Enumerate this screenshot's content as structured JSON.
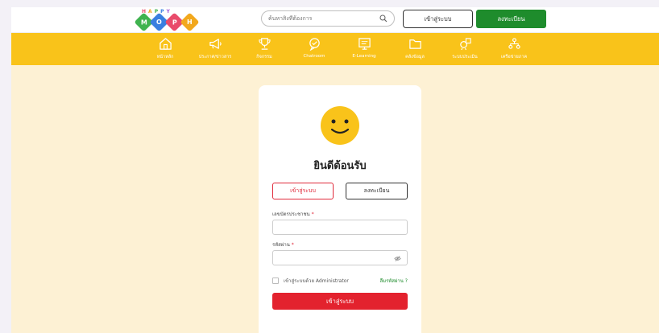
{
  "header": {
    "logo_word": "HAPPY",
    "logo_letters": [
      "M",
      "O",
      "P",
      "H"
    ],
    "logo_colors": [
      "#3fb34f",
      "#3a7fe0",
      "#e94b6b",
      "#f2a81d"
    ],
    "search_placeholder": "ค้นหาสิ่งที่ต้องการ",
    "login_label": "เข้าสู่ระบบ",
    "register_label": "ลงทะเบียน"
  },
  "nav": [
    {
      "label": "หน้าหลัก",
      "icon": "home-icon"
    },
    {
      "label": "ประกาศ/ข่าวสาร",
      "icon": "megaphone-icon"
    },
    {
      "label": "กิจกรรม",
      "icon": "trophy-icon"
    },
    {
      "label": "Chatroom",
      "icon": "chat-icon"
    },
    {
      "label": "E-Learning",
      "icon": "elearning-icon"
    },
    {
      "label": "คลังข้อมูล",
      "icon": "folder-icon"
    },
    {
      "label": "ระบบประเมิน",
      "icon": "assessment-icon"
    },
    {
      "label": "เครือข่ายภาค",
      "icon": "network-icon"
    }
  ],
  "login": {
    "welcome": "ยินดีต้อนรับ",
    "tab_login": "เข้าสู่ระบบ",
    "tab_register": "ลงทะเบียน",
    "id_label": "เลขบัตรประชาชน",
    "id_value": "",
    "password_label": "รหัสผ่าน",
    "password_value": "",
    "required_mark": "*",
    "admin_label": "เข้าสู่ระบบด้วย Administrator",
    "forgot_label": "ลืมรหัสผ่าน ?",
    "submit_label": "เข้าสู่ระบบ"
  },
  "colors": {
    "nav_bg": "#f9c31a",
    "page_bg": "#fdf1d4",
    "accent_red": "#e3222e",
    "accent_green": "#1e8c2c"
  }
}
